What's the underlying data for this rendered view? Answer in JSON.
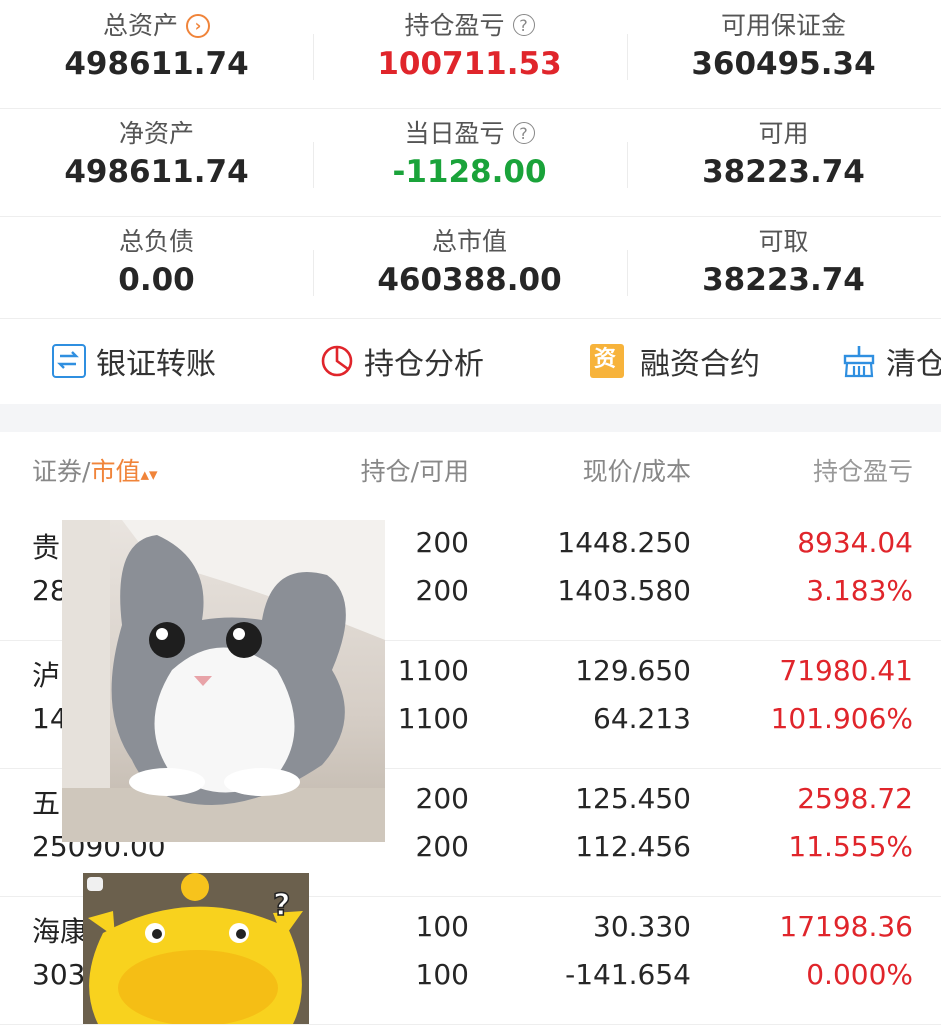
{
  "summary": {
    "rows": [
      [
        {
          "label": "总资产",
          "value": "498611.74",
          "icon": "chevron-right-circle-icon"
        },
        {
          "label": "持仓盈亏",
          "value": "100711.53",
          "icon": "help-circle-icon",
          "color": "#e0252b"
        },
        {
          "label": "可用保证金",
          "value": "360495.34"
        }
      ],
      [
        {
          "label": "净资产",
          "value": "498611.74"
        },
        {
          "label": "当日盈亏",
          "value": "-1128.00",
          "icon": "help-circle-icon",
          "color": "#1aa33a"
        },
        {
          "label": "可用",
          "value": "38223.74"
        }
      ],
      [
        {
          "label": "总负债",
          "value": "0.00"
        },
        {
          "label": "总市值",
          "value": "460388.00"
        },
        {
          "label": "可取",
          "value": "38223.74"
        }
      ]
    ]
  },
  "actions": [
    {
      "label": "银证转账",
      "icon": "bank-transfer-icon",
      "color": "#2f8fe0"
    },
    {
      "label": "持仓分析",
      "icon": "pie-chart-icon",
      "color": "#e0252b"
    },
    {
      "label": "融资合约",
      "icon": "contract-icon",
      "color": "#f0a030"
    },
    {
      "label": "清仓",
      "icon": "broom-icon",
      "color": "#2f8fe0"
    }
  ],
  "table": {
    "headers": {
      "col1_prefix": "证券/",
      "col1_sort": "市值",
      "col2": "持仓/可用",
      "col3": "现价/成本",
      "col4": "持仓盈亏"
    },
    "rows": [
      {
        "name": "贵",
        "market_value": "28",
        "position": "200",
        "available": "200",
        "price": "1448.250",
        "cost": "1403.580",
        "pnl": "8934.04",
        "pnl_pct": "3.183%"
      },
      {
        "name": "泸",
        "market_value": "14",
        "position": "1100",
        "available": "1100",
        "price": "129.650",
        "cost": "64.213",
        "pnl": "71980.41",
        "pnl_pct": "101.906%"
      },
      {
        "name": "五",
        "market_value": "25090.00",
        "position": "200",
        "available": "200",
        "price": "125.450",
        "cost": "112.456",
        "pnl": "2598.72",
        "pnl_pct": "11.555%"
      },
      {
        "name": "海康",
        "market_value": "303",
        "position": "100",
        "available": "100",
        "price": "30.330",
        "cost": "-141.654",
        "pnl": "17198.36",
        "pnl_pct": "0.000%"
      }
    ]
  },
  "colors": {
    "profit": "#e0252b",
    "loss": "#1aa33a",
    "accent": "#f0843a"
  }
}
